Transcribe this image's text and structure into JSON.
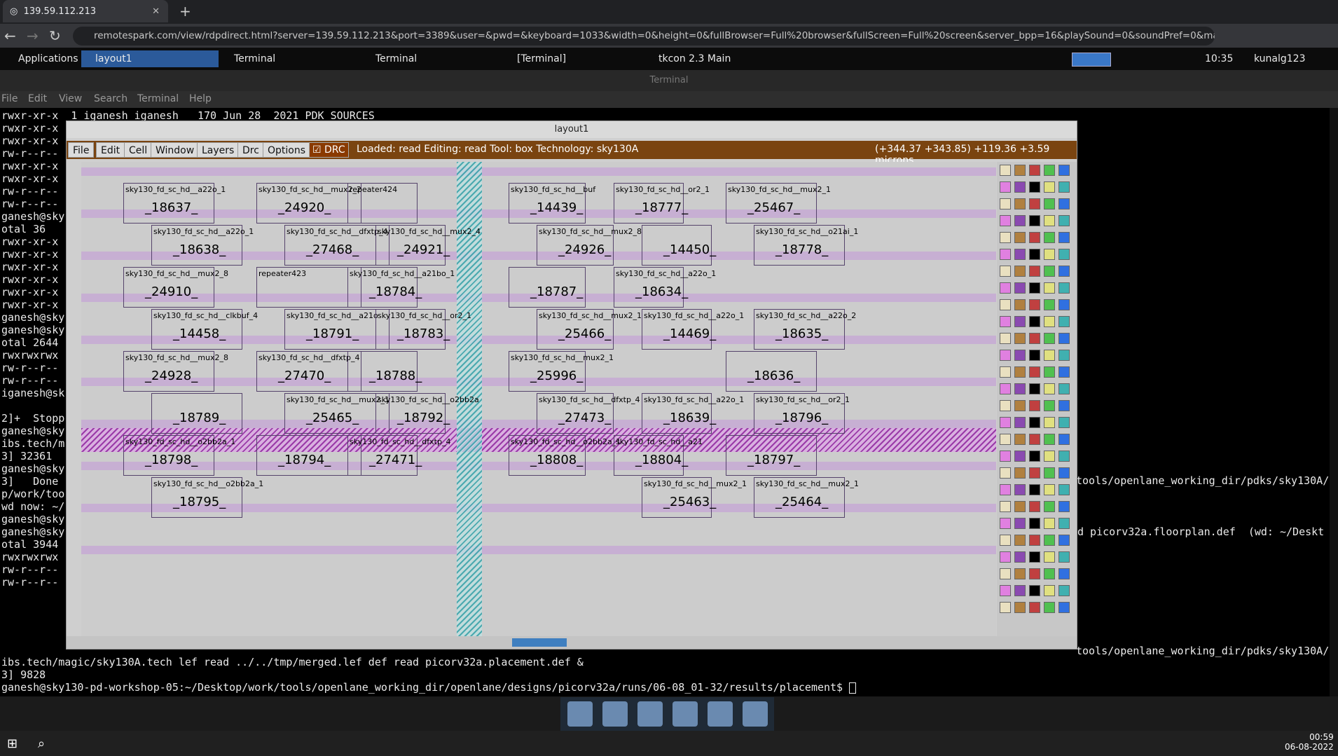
{
  "browser": {
    "tab_title": "139.59.112.213",
    "new_tab": "+",
    "url": "remotespark.com/view/rdpdirect.html?server=139.59.112.213&port=3389&user=&pwd=&keyboard=1033&width=0&height=0&fullBrowser=Full%20browser&fullScreen=Full%20screen&server_bpp=16&playSound=0&soundPref=0&mapClipboard=on&ma..."
  },
  "panel": {
    "applications": "Applications",
    "tasks": [
      "layout1",
      "Terminal",
      "Terminal",
      "[Terminal]",
      "tkcon 2.3 Main"
    ],
    "time": "10:35",
    "user": "kunalg123"
  },
  "terminal": {
    "title": "Terminal",
    "menu": [
      "File",
      "Edit",
      "View",
      "Search",
      "Terminal",
      "Help"
    ],
    "lines": [
      "rwxr-xr-x  1 iganesh iganesh   170 Jun 28  2021 PDK_SOURCES",
      "rwxr-xr-x",
      "rwxr-xr-x",
      "rw-r--r--",
      "rwxr-xr-x",
      "rwxr-xr-x",
      "rw-r--r--",
      "rw-r--r--",
      "ganesh@sky",
      "otal 36",
      "rwxr-xr-x",
      "rwxr-xr-x",
      "rwxr-xr-x",
      "rwxr-xr-x",
      "rwxr-xr-x",
      "rwxr-xr-x",
      "ganesh@sky",
      "ganesh@sky",
      "otal 2644",
      "rwxrwxrwx",
      "rw-r--r--",
      "rw-r--r--",
      "iganesh@sk",
      "",
      "2]+  Stopp",
      "ganesh@sky",
      "ibs.tech/m",
      "3] 32361",
      "ganesh@sky",
      "3]   Done",
      "p/work/too",
      "wd now: ~/",
      "ganesh@sky",
      "ganesh@sky",
      "otal 3944",
      "rwxrwxrwx",
      "rw-r--r--",
      "rw-r--r--"
    ],
    "right1": "tools/openlane_working_dir/pdks/sky130A/",
    "right2": "d picorv32a.floorplan.def  (wd: ~/Deskt",
    "right3": "tools/openlane_working_dir/pdks/sky130A/",
    "cmd": "ibs.tech/magic/sky130A.tech lef read ../../tmp/merged.lef def read picorv32a.placement.def &",
    "pid": "3] 9828",
    "prompt": "ganesh@sky130-pd-workshop-05:~/Desktop/work/tools/openlane_working_dir/openlane/designs/picorv32a/runs/06-08_01-32/results/placement$ "
  },
  "magic": {
    "title": "layout1",
    "menu": [
      "File",
      "Edit",
      "Cell",
      "Window",
      "Layers",
      "Drc",
      "Options"
    ],
    "drc": "DRC",
    "status": "Loaded: read Editing: read Tool: box  Technology: sky130A",
    "coords": "(+344.37 +343.85) +119.36 +3.59 microns",
    "cells": [
      {
        "t": "sky130_fd_sc_hd__a22o_1",
        "n": "_18637_"
      },
      {
        "t": "sky130_fd_sc_hd__mux2_2",
        "n": "_24920_"
      },
      {
        "t": "repeater424",
        "n": ""
      },
      {
        "t": "sky130_fd_sc_hd__buf",
        "n": "_14439_"
      },
      {
        "t": "sky130_fd_sc_hd__or2_1",
        "n": "_18777_"
      },
      {
        "t": "sky130_fd_sc_hd__mux2_1",
        "n": "_25467_"
      },
      {
        "t": "sky130_fd_sc_hd__a22o_1",
        "n": "_18638_"
      },
      {
        "t": "sky130_fd_sc_hd__dfxtp_4",
        "n": "_27468_"
      },
      {
        "t": "sky130_fd_sc_hd__mux2_4",
        "n": "_24921_"
      },
      {
        "t": "sky130_fd_sc_hd__mux2_8",
        "n": "_24926_"
      },
      {
        "t": "",
        "n": "_14450_"
      },
      {
        "t": "sky130_fd_sc_hd__o21ai_1",
        "n": "_18778_"
      },
      {
        "t": "sky130_fd_sc_hd__mux2_8",
        "n": "_24910_"
      },
      {
        "t": "repeater423",
        "n": ""
      },
      {
        "t": "sky130_fd_sc_hd__a21bo_1",
        "n": "_18784_"
      },
      {
        "t": "",
        "n": "_18787_"
      },
      {
        "t": "sky130_fd_sc_hd__a22o_1",
        "n": "_18634_"
      },
      {
        "t": "sky130_fd_sc_hd__a22o_2",
        "n": "_18635_"
      },
      {
        "t": "sky130_fd_sc_hd__clkbuf_4",
        "n": "_14458_"
      },
      {
        "t": "sky130_fd_sc_hd__a21o",
        "n": "_18791_"
      },
      {
        "t": "sky130_fd_sc_hd__or2_1",
        "n": "_18783_"
      },
      {
        "t": "sky130_fd_sc_hd__mux2_1",
        "n": "_25466_"
      },
      {
        "t": "sky130_fd_sc_hd__a22o_1",
        "n": "_14469_"
      },
      {
        "t": "",
        "n": "_18636_"
      },
      {
        "t": "sky130_fd_sc_hd__mux2_8",
        "n": "_24928_"
      },
      {
        "t": "sky130_fd_sc_hd__dfxtp_4",
        "n": "_27470_"
      },
      {
        "t": "",
        "n": "_18788_"
      },
      {
        "t": "sky130_fd_sc_hd__mux2_1",
        "n": "_25996_"
      },
      {
        "t": "sky130_fd_sc_hd__a22o_1",
        "n": "_18639_"
      },
      {
        "t": "sky130_fd_sc_hd__or2_1",
        "n": "_18796_"
      },
      {
        "t": "",
        "n": "_18789_"
      },
      {
        "t": "sky130_fd_sc_hd__mux2_1",
        "n": "_25465_"
      },
      {
        "t": "sky130_fd_sc_hd__o2bb2a",
        "n": "_18792_"
      },
      {
        "t": "sky130_fd_sc_hd__dfxtp_4",
        "n": "_27473_"
      },
      {
        "t": "sky130_fd_sc_hd__a21",
        "n": "_18804_"
      },
      {
        "t": "",
        "n": "_18797_"
      },
      {
        "t": "sky130_fd_sc_hd__o2bb2a_1",
        "n": "_18798_"
      },
      {
        "t": "",
        "n": "_18794_"
      },
      {
        "t": "sky130_fd_sc_hd__dfxtp_4",
        "n": "_27471_"
      },
      {
        "t": "sky130_fd_sc_hd__o2bb2a_1",
        "n": "_18808_"
      },
      {
        "t": "sky130_fd_sc_hd__mux2_1",
        "n": "_25463_"
      },
      {
        "t": "sky130_fd_sc_hd__mux2_1",
        "n": "_25464_"
      },
      {
        "t": "sky130_fd_sc_hd__o2bb2a_1",
        "n": "_18795_"
      }
    ]
  },
  "dock": [
    "screen",
    "terminal",
    "files",
    "browser",
    "search",
    "folder"
  ],
  "clock": {
    "time": "00:59",
    "date": "06-08-2022"
  }
}
